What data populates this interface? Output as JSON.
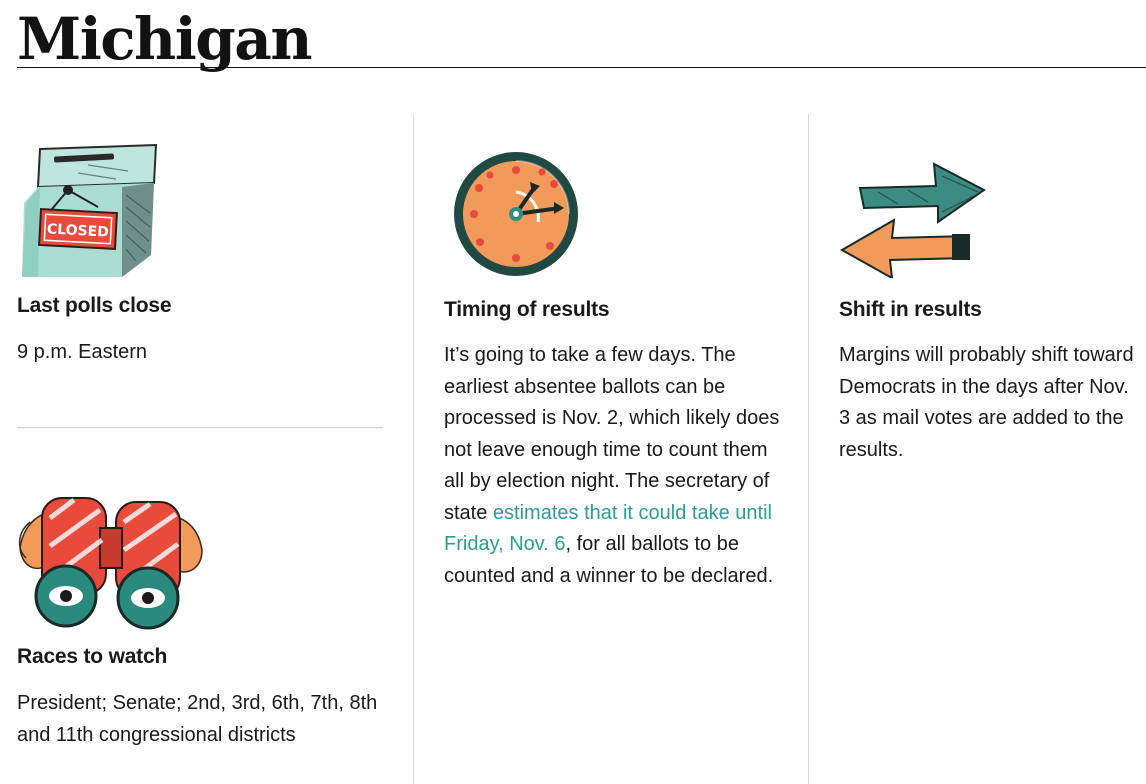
{
  "page": {
    "title": "Michigan"
  },
  "panels": {
    "polls_close": {
      "heading": "Last polls close",
      "text": "9 p.m. Eastern",
      "sign_text": "CLOSED"
    },
    "races": {
      "heading": "Races to watch",
      "text": "President; Senate; 2nd, 3rd, 6th, 7th, 8th and 11th congressional districts"
    },
    "timing": {
      "heading": "Timing of results",
      "text_before": "It’s going to take a few days. The earliest absentee ballots can be processed is Nov. 2, which likely does not leave enough time to count them all by election night. The secretary of state ",
      "link_text": "estimates that it could take until Friday, Nov. 6",
      "text_after": ", for all ballots to be counted and a winner to be declared."
    },
    "shift": {
      "heading": "Shift in results",
      "text": "Margins will probably shift toward Democrats in the days after Nov. 3 as mail votes are added to the results."
    }
  },
  "icons": [
    "ballot-box-icon",
    "binoculars-icon",
    "clock-icon",
    "shift-arrows-icon"
  ],
  "colors": {
    "link": "#2a9d95",
    "accent_red": "#e84a3c",
    "accent_teal": "#2f8f86",
    "accent_orange": "#f29a5a"
  }
}
